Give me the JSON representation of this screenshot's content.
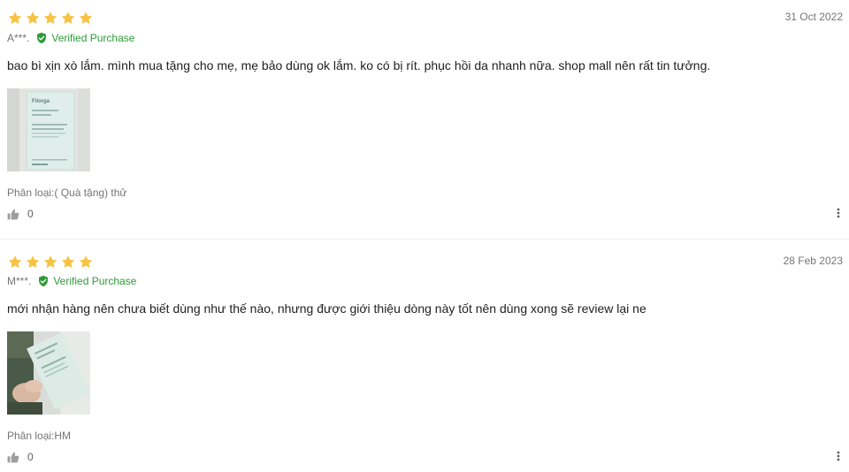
{
  "colors": {
    "star": "#f6c342",
    "verified": "#2e9b37",
    "muted": "#757575",
    "divider": "#eeeeee"
  },
  "reviews": [
    {
      "rating": 5,
      "date": "31 Oct 2022",
      "user": "A***.",
      "verified_label": "Verified Purchase",
      "text": "bao bì xịn xò lắm. mình mua tặng cho mẹ, mẹ bảo dùng ok lắm. ko có bị rít. phục hồi da nhanh nữa. shop mall nên rất tin tưởng.",
      "variant": "Phân loại:( Quà tặng) thử",
      "likes": "0",
      "thumb_label": "Filorga"
    },
    {
      "rating": 5,
      "date": "28 Feb 2023",
      "user": "M***.",
      "verified_label": "Verified Purchase",
      "text": "mới nhận hàng nên chưa biết dùng như thế nào, nhưng được giới thiệu dòng này tốt nên dùng xong sẽ review lại ne",
      "variant": "Phân loại:HM",
      "likes": "0",
      "thumb_label": "Filorga"
    }
  ],
  "icons": {
    "star": "star-icon",
    "verified": "verified-check-icon",
    "like": "thumbs-up-icon",
    "more": "more-vertical-icon"
  }
}
